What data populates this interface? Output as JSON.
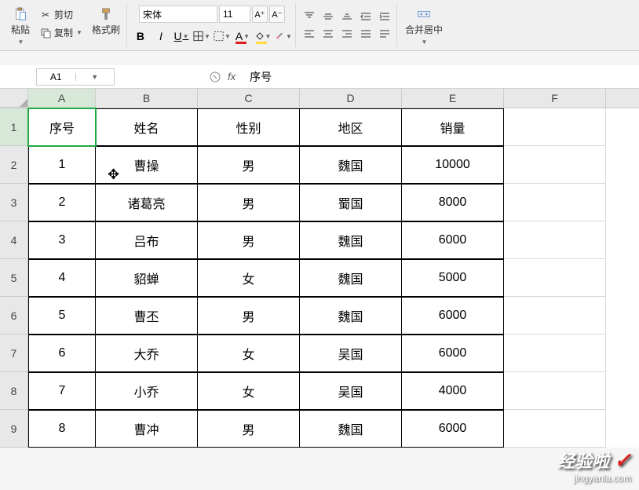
{
  "ribbon": {
    "paste": "粘贴",
    "cut": "剪切",
    "copy": "复制",
    "format_painter": "格式刷",
    "font_name": "宋体",
    "font_size": "11",
    "merge_center": "合并居中"
  },
  "namebox": "A1",
  "formula_value": "序号",
  "columns": [
    "A",
    "B",
    "C",
    "D",
    "E",
    "F"
  ],
  "row_numbers": [
    "1",
    "2",
    "3",
    "4",
    "5",
    "6",
    "7",
    "8",
    "9"
  ],
  "table": {
    "headers": [
      "序号",
      "姓名",
      "性别",
      "地区",
      "销量"
    ],
    "rows": [
      [
        "1",
        "曹操",
        "男",
        "魏国",
        "10000"
      ],
      [
        "2",
        "诸葛亮",
        "男",
        "蜀国",
        "8000"
      ],
      [
        "3",
        "吕布",
        "男",
        "魏国",
        "6000"
      ],
      [
        "4",
        "貂蝉",
        "女",
        "魏国",
        "5000"
      ],
      [
        "5",
        "曹丕",
        "男",
        "魏国",
        "6000"
      ],
      [
        "6",
        "大乔",
        "女",
        "吴国",
        "6000"
      ],
      [
        "7",
        "小乔",
        "女",
        "吴国",
        "4000"
      ],
      [
        "8",
        "曹冲",
        "男",
        "魏国",
        "6000"
      ]
    ]
  },
  "watermark": {
    "line1": "经验啦",
    "line2": "jingyanla.com"
  }
}
